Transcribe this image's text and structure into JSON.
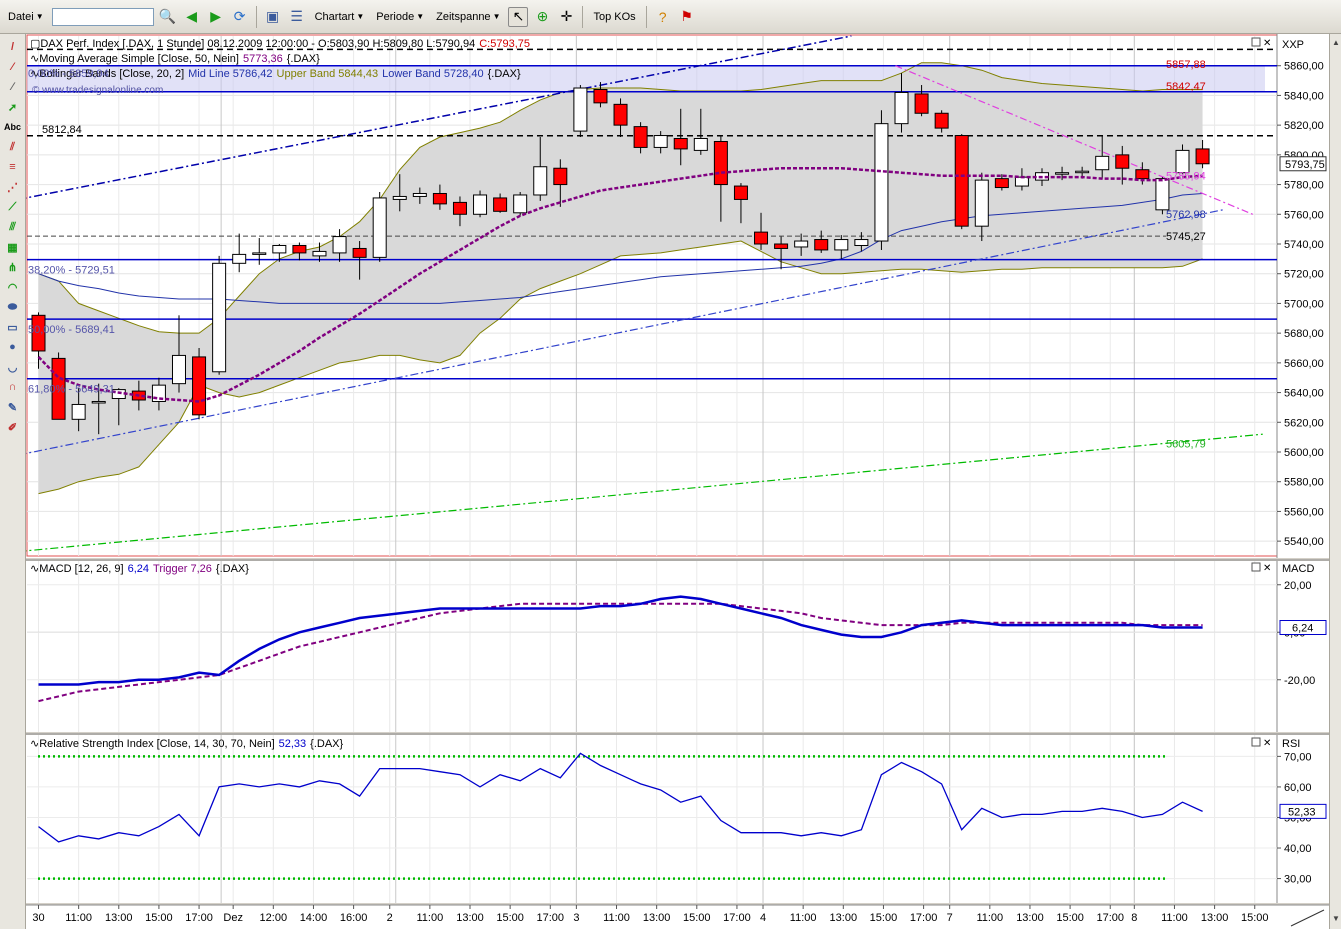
{
  "toolbar": {
    "menu_datei": "Datei",
    "menu_chartart": "Chartart",
    "menu_periode": "Periode",
    "menu_zeitspanne": "Zeitspanne",
    "topkos": "Top KOs",
    "search_value": ""
  },
  "colors": {
    "bull": "#ffffff",
    "bear": "#ff0000",
    "mavg": "#800080",
    "bb_mid": "#2233aa",
    "bb_band": "#808000",
    "horiz": "#0000cc",
    "macd": "#0000cc",
    "trigger": "#800080",
    "rsi": "#0000cc",
    "rsi_levels": "#00bb00",
    "fib_zone": "#c8c8f0"
  },
  "price_panel": {
    "legend_line1_prefix": "DAX Perf. Index [.DAX, 1 Stunde] 08.12.2009 12:00:00 - O:5803,90 H:5809,80 L:5790,94",
    "legend_line1_close": "C:5793,75",
    "legend_line2_prefix": "Moving Average Simple [Close, 50, Nein]",
    "legend_line2_value": "5773,36",
    "legend_line2_suffix": "{.DAX}",
    "legend_line3_prefix": "Bollinger Bands [Close, 20, 2]",
    "legend_line3_mid": "Mid Line 5786,42",
    "legend_line3_upper": "Upper Band 5844,43",
    "legend_line3_lower": "Lower Band 5728,40",
    "legend_line3_suffix": "{.DAX}",
    "watermark": "© www.tradesignalonline.com",
    "axis_title": "XXP",
    "fib_0": "0,00% - 5859,94",
    "fib_382": "38,20% - 5729,51",
    "fib_50": "50,00% - 5689,41",
    "fib_618": "61,80% - 5649,31",
    "level_5812": "5812,84",
    "label_5857": "5857,88",
    "label_5842": "5842,47",
    "label_5785": "5785,94",
    "label_5762": "5762,98",
    "label_5745": "5745,27",
    "label_5605": "5605,79",
    "last_price": "5793,75"
  },
  "macd_panel": {
    "legend_prefix": "MACD [12, 26, 9]",
    "legend_value": "6,24",
    "legend_trigger": "Trigger 7,26",
    "legend_suffix": "{.DAX}",
    "axis_title": "MACD",
    "last_value": "6,24"
  },
  "rsi_panel": {
    "legend_prefix": "Relative Strength Index [Close, 14, 30, 70, Nein]",
    "legend_value": "52,33",
    "legend_suffix": "{.DAX}",
    "axis_title": "RSI",
    "last_value": "52,33"
  },
  "chart_data": {
    "type": "candlestick",
    "title": "DAX Perf. Index [.DAX, 1 Stunde]",
    "ylim": [
      5530,
      5880
    ],
    "x_labels": [
      "30",
      "11:00",
      "13:00",
      "15:00",
      "17:00",
      "Dez",
      "12:00",
      "14:00",
      "16:00",
      "2",
      "11:00",
      "13:00",
      "15:00",
      "17:00",
      "3",
      "11:00",
      "13:00",
      "15:00",
      "17:00",
      "4",
      "11:00",
      "13:00",
      "15:00",
      "17:00",
      "7",
      "11:00",
      "13:00",
      "15:00",
      "17:00",
      "8",
      "11:00",
      "13:00",
      "15:00"
    ],
    "x_label_bars": [
      0,
      2,
      4,
      6,
      8,
      9.7,
      11.7,
      13.7,
      15.7,
      17.5,
      19.5,
      21.5,
      23.5,
      25.5,
      26.8,
      28.8,
      30.8,
      32.8,
      34.8,
      36.1,
      38.1,
      40.1,
      42.1,
      44.1,
      45.4,
      47.4,
      49.4,
      51.4,
      53.4,
      54.6,
      56.6,
      58.6,
      60.6
    ],
    "day_separators": [
      9.1,
      17.8,
      26.8,
      36.1,
      45.4,
      54.6
    ],
    "price_ticks": [
      5860,
      5840,
      5820,
      5800,
      5780,
      5760,
      5740,
      5720,
      5700,
      5680,
      5660,
      5640,
      5620,
      5600,
      5580,
      5560,
      5540
    ],
    "candles": [
      {
        "o": 5692,
        "h": 5694,
        "l": 5656,
        "c": 5668
      },
      {
        "o": 5663,
        "h": 5667,
        "l": 5622,
        "c": 5622
      },
      {
        "o": 5622,
        "h": 5643,
        "l": 5614,
        "c": 5632
      },
      {
        "o": 5634,
        "h": 5646,
        "l": 5612,
        "c": 5634
      },
      {
        "o": 5636,
        "h": 5643,
        "l": 5618,
        "c": 5642
      },
      {
        "o": 5641,
        "h": 5648,
        "l": 5628,
        "c": 5635
      },
      {
        "o": 5634,
        "h": 5650,
        "l": 5628,
        "c": 5645
      },
      {
        "o": 5646,
        "h": 5692,
        "l": 5640,
        "c": 5665
      },
      {
        "o": 5664,
        "h": 5670,
        "l": 5622,
        "c": 5625
      },
      {
        "o": 5654,
        "h": 5732,
        "l": 5652,
        "c": 5727
      },
      {
        "o": 5727,
        "h": 5747,
        "l": 5721,
        "c": 5733
      },
      {
        "o": 5733,
        "h": 5744,
        "l": 5726,
        "c": 5734
      },
      {
        "o": 5734,
        "h": 5740,
        "l": 5728,
        "c": 5739
      },
      {
        "o": 5739,
        "h": 5741,
        "l": 5729,
        "c": 5734
      },
      {
        "o": 5732,
        "h": 5741,
        "l": 5728,
        "c": 5735
      },
      {
        "o": 5734,
        "h": 5750,
        "l": 5728,
        "c": 5745
      },
      {
        "o": 5737,
        "h": 5742,
        "l": 5716,
        "c": 5731
      },
      {
        "o": 5731,
        "h": 5775,
        "l": 5728,
        "c": 5771
      },
      {
        "o": 5770,
        "h": 5787,
        "l": 5762,
        "c": 5772
      },
      {
        "o": 5772,
        "h": 5778,
        "l": 5767,
        "c": 5774
      },
      {
        "o": 5774,
        "h": 5780,
        "l": 5763,
        "c": 5767
      },
      {
        "o": 5768,
        "h": 5772,
        "l": 5752,
        "c": 5760
      },
      {
        "o": 5760,
        "h": 5776,
        "l": 5758,
        "c": 5773
      },
      {
        "o": 5771,
        "h": 5774,
        "l": 5761,
        "c": 5762
      },
      {
        "o": 5761,
        "h": 5775,
        "l": 5759,
        "c": 5773
      },
      {
        "o": 5773,
        "h": 5812,
        "l": 5769,
        "c": 5792
      },
      {
        "o": 5791,
        "h": 5797,
        "l": 5765,
        "c": 5780
      },
      {
        "o": 5816,
        "h": 5847,
        "l": 5812,
        "c": 5845
      },
      {
        "o": 5844,
        "h": 5849,
        "l": 5832,
        "c": 5835
      },
      {
        "o": 5834,
        "h": 5838,
        "l": 5812,
        "c": 5820
      },
      {
        "o": 5819,
        "h": 5822,
        "l": 5801,
        "c": 5805
      },
      {
        "o": 5805,
        "h": 5816,
        "l": 5801,
        "c": 5813
      },
      {
        "o": 5811,
        "h": 5831,
        "l": 5793,
        "c": 5804
      },
      {
        "o": 5803,
        "h": 5831,
        "l": 5800,
        "c": 5811
      },
      {
        "o": 5809,
        "h": 5813,
        "l": 5755,
        "c": 5780
      },
      {
        "o": 5779,
        "h": 5781,
        "l": 5754,
        "c": 5770
      },
      {
        "o": 5748,
        "h": 5761,
        "l": 5736,
        "c": 5740
      },
      {
        "o": 5740,
        "h": 5745,
        "l": 5723,
        "c": 5737
      },
      {
        "o": 5738,
        "h": 5747,
        "l": 5732,
        "c": 5742
      },
      {
        "o": 5743,
        "h": 5749,
        "l": 5734,
        "c": 5736
      },
      {
        "o": 5736,
        "h": 5746,
        "l": 5730,
        "c": 5743
      },
      {
        "o": 5739,
        "h": 5748,
        "l": 5735,
        "c": 5743
      },
      {
        "o": 5742,
        "h": 5830,
        "l": 5736,
        "c": 5821
      },
      {
        "o": 5821,
        "h": 5855,
        "l": 5815,
        "c": 5842
      },
      {
        "o": 5841,
        "h": 5847,
        "l": 5826,
        "c": 5828
      },
      {
        "o": 5828,
        "h": 5830,
        "l": 5815,
        "c": 5818
      },
      {
        "o": 5813,
        "h": 5814,
        "l": 5750,
        "c": 5752
      },
      {
        "o": 5752,
        "h": 5788,
        "l": 5742,
        "c": 5783
      },
      {
        "o": 5784,
        "h": 5787,
        "l": 5776,
        "c": 5778
      },
      {
        "o": 5779,
        "h": 5791,
        "l": 5776,
        "c": 5785
      },
      {
        "o": 5783,
        "h": 5791,
        "l": 5779,
        "c": 5788
      },
      {
        "o": 5787,
        "h": 5792,
        "l": 5783,
        "c": 5788
      },
      {
        "o": 5788,
        "h": 5792,
        "l": 5784,
        "c": 5789
      },
      {
        "o": 5790,
        "h": 5813,
        "l": 5784,
        "c": 5799
      },
      {
        "o": 5800,
        "h": 5806,
        "l": 5780,
        "c": 5791
      },
      {
        "o": 5790,
        "h": 5795,
        "l": 5780,
        "c": 5784
      },
      {
        "o": 5763,
        "h": 5785,
        "l": 5760,
        "c": 5784
      },
      {
        "o": 5788,
        "h": 5807,
        "l": 5787,
        "c": 5803
      },
      {
        "o": 5804,
        "h": 5810,
        "l": 5791,
        "c": 5794
      }
    ],
    "sma50": [
      5664,
      5650,
      5645,
      5642,
      5640,
      5638,
      5636,
      5635,
      5634,
      5638,
      5645,
      5652,
      5660,
      5668,
      5677,
      5685,
      5693,
      5702,
      5711,
      5720,
      5728,
      5736,
      5744,
      5752,
      5759,
      5764,
      5768,
      5772,
      5776,
      5778,
      5780,
      5782,
      5784,
      5786,
      5788,
      5789,
      5790,
      5791,
      5791,
      5791,
      5791,
      5790,
      5789,
      5788,
      5787,
      5786,
      5786,
      5786,
      5786,
      5785,
      5785,
      5785,
      5785,
      5784,
      5784,
      5783,
      5783,
      5785,
      5786
    ],
    "bb_upper": [
      5720,
      5715,
      5700,
      5695,
      5690,
      5685,
      5681,
      5680,
      5680,
      5690,
      5705,
      5720,
      5730,
      5735,
      5738,
      5745,
      5755,
      5770,
      5790,
      5805,
      5812,
      5815,
      5818,
      5822,
      5830,
      5837,
      5842,
      5844,
      5845,
      5845,
      5845,
      5844,
      5843,
      5843,
      5843,
      5843,
      5844,
      5846,
      5848,
      5850,
      5850,
      5850,
      5850,
      5855,
      5862,
      5862,
      5860,
      5857,
      5852,
      5850,
      5848,
      5847,
      5846,
      5845,
      5844,
      5843,
      5844,
      5844,
      5844
    ],
    "bb_mid": [
      5720,
      5715,
      5712,
      5710,
      5707,
      5705,
      5704,
      5703,
      5703,
      5703,
      5702,
      5701,
      5700,
      5700,
      5700,
      5700,
      5700,
      5700,
      5700,
      5700,
      5700,
      5701,
      5702,
      5703,
      5704,
      5706,
      5708,
      5710,
      5712,
      5714,
      5716,
      5718,
      5719,
      5720,
      5721,
      5722,
      5723,
      5724,
      5725,
      5727,
      5730,
      5735,
      5743,
      5749,
      5752,
      5755,
      5757,
      5759,
      5760,
      5761,
      5762,
      5763,
      5764,
      5765,
      5766,
      5768,
      5770,
      5773,
      5774
    ],
    "bb_lower": [
      5572,
      5575,
      5580,
      5583,
      5585,
      5590,
      5605,
      5620,
      5645,
      5640,
      5637,
      5640,
      5645,
      5650,
      5655,
      5660,
      5662,
      5665,
      5665,
      5662,
      5660,
      5665,
      5680,
      5690,
      5703,
      5710,
      5715,
      5720,
      5726,
      5732,
      5733,
      5734,
      5736,
      5738,
      5740,
      5742,
      5735,
      5728,
      5724,
      5720,
      5720,
      5721,
      5722,
      5723,
      5723,
      5722,
      5721,
      5722,
      5723,
      5723,
      5724,
      5724,
      5724,
      5724,
      5724,
      5724,
      5724,
      5725,
      5730
    ],
    "macd": [
      -22,
      -22,
      -22,
      -21,
      -21,
      -20,
      -20,
      -19,
      -17,
      -18,
      -12,
      -7,
      -3,
      0,
      2,
      4,
      6,
      7,
      8,
      9,
      10,
      10,
      10,
      10,
      10,
      10,
      10,
      10,
      11,
      11,
      12,
      14,
      15,
      14,
      12,
      10,
      8,
      6,
      3,
      1,
      -1,
      -2,
      -2,
      0,
      3,
      4,
      5,
      4,
      3,
      3,
      3,
      3,
      3,
      3,
      3,
      3,
      2,
      2,
      2
    ],
    "macd_trigger": [
      -29,
      -27,
      -25,
      -24,
      -23,
      -22,
      -21,
      -20,
      -19,
      -18,
      -15,
      -12,
      -9,
      -6,
      -4,
      -2,
      0,
      2,
      4,
      6,
      8,
      9,
      10,
      11,
      12,
      12,
      12,
      12,
      12,
      12,
      12,
      12,
      12,
      12,
      12,
      11,
      10,
      9,
      8,
      6,
      5,
      4,
      3,
      3,
      3,
      3,
      4,
      4,
      4,
      4,
      4,
      4,
      4,
      4,
      4,
      3,
      3,
      3,
      3
    ],
    "macd_ticks": [
      20,
      0,
      -20
    ],
    "macd_ylim": [
      -42,
      30
    ],
    "rsi": [
      47,
      42,
      44,
      43,
      45,
      44,
      47,
      51,
      44,
      60,
      61,
      60,
      61,
      60,
      62,
      61,
      57,
      66,
      66,
      66,
      65,
      64,
      60,
      64,
      62,
      66,
      63,
      71,
      67,
      64,
      61,
      59,
      55,
      57,
      49,
      45,
      45,
      45,
      44,
      45,
      44,
      46,
      64,
      68,
      65,
      61,
      46,
      53,
      50,
      51,
      51,
      52,
      52,
      53,
      52,
      50,
      51,
      55,
      52
    ],
    "rsi_ticks": [
      70,
      60,
      50,
      40,
      30
    ],
    "rsi_levels": [
      30,
      70
    ],
    "rsi_ylim": [
      22,
      77
    ],
    "fib_lines": [
      5859.94,
      5842.47,
      5729.51,
      5689.41,
      5649.31
    ],
    "level_dashed_top": 5871,
    "level_dashed": 5812.84,
    "level_dashed_low": 5745.27,
    "trend_upper": {
      "from": [
        -1,
        5770
      ],
      "to": [
        40.5,
        5880
      ]
    },
    "trend_mid": {
      "from": [
        -1,
        5598
      ],
      "to": [
        59,
        5762.98
      ]
    },
    "trend_lower": {
      "from": [
        -1,
        5533
      ],
      "to": [
        61,
        5612
      ]
    },
    "trend_pink": {
      "from": [
        42.7,
        5860
      ],
      "to": [
        60.5,
        5760
      ]
    }
  }
}
